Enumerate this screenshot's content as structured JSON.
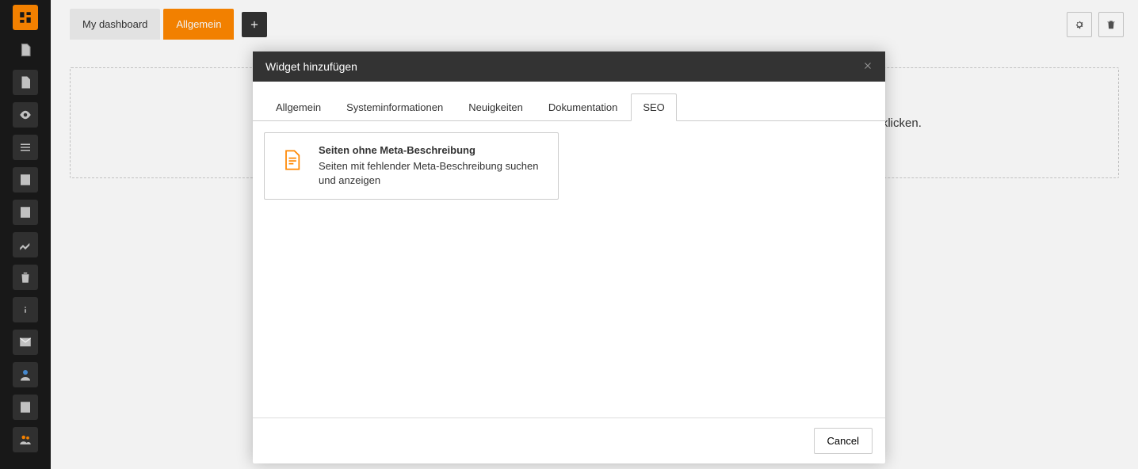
{
  "sidebar": {
    "items": [
      {
        "name": "dashboard",
        "active": true
      },
      {
        "name": "page",
        "active": false
      },
      {
        "name": "list",
        "active": false
      },
      {
        "name": "view",
        "active": false
      },
      {
        "name": "list2",
        "active": false
      },
      {
        "name": "form",
        "active": false
      },
      {
        "name": "template",
        "active": false
      },
      {
        "name": "info",
        "active": false
      },
      {
        "name": "recycle",
        "active": false
      },
      {
        "name": "about",
        "active": false
      },
      {
        "name": "scheduler",
        "active": false
      },
      {
        "name": "users",
        "active": false
      },
      {
        "name": "reports",
        "active": false
      },
      {
        "name": "group",
        "active": false
      }
    ]
  },
  "topbar": {
    "tabs": [
      {
        "label": "My dashboard",
        "active": false
      },
      {
        "label": "Allgemein",
        "active": true
      }
    ],
    "add_icon": "plus-icon"
  },
  "content": {
    "empty_message": "Es sind noch keine Widgets vorhanden. Ein neues Widget lässt sich hinzufügen, indem Sie auf den \"+\"-Button unten klicken."
  },
  "modal": {
    "title": "Widget hinzufügen",
    "tabs": [
      {
        "label": "Allgemein",
        "active": false
      },
      {
        "label": "Systeminformationen",
        "active": false
      },
      {
        "label": "Neuigkeiten",
        "active": false
      },
      {
        "label": "Dokumentation",
        "active": false
      },
      {
        "label": "SEO",
        "active": true
      }
    ],
    "widgets": [
      {
        "title": "Seiten ohne Meta-Beschreibung",
        "description": "Seiten mit fehlender Meta-Beschreibung suchen und anzeigen"
      }
    ],
    "cancel_label": "Cancel"
  }
}
